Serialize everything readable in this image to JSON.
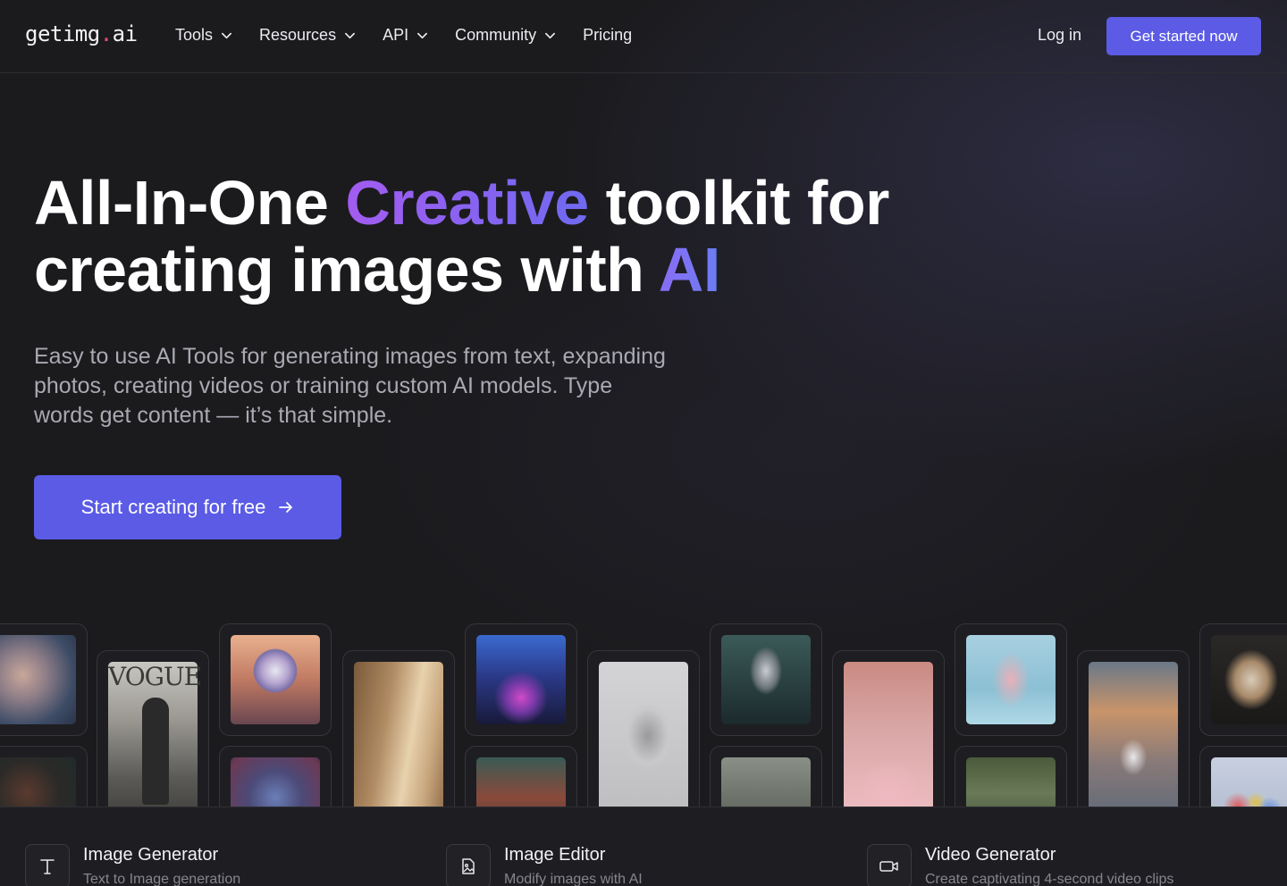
{
  "brand": {
    "logo_pre": "getimg",
    "logo_dot": ".",
    "logo_post": "ai"
  },
  "nav": {
    "items": [
      {
        "label": "Tools",
        "has_dropdown": true
      },
      {
        "label": "Resources",
        "has_dropdown": true
      },
      {
        "label": "API",
        "has_dropdown": true
      },
      {
        "label": "Community",
        "has_dropdown": true
      },
      {
        "label": "Pricing",
        "has_dropdown": false
      }
    ],
    "login": "Log in",
    "cta": "Get started now"
  },
  "hero": {
    "line1_a": "All-In-One ",
    "line1_highlight": "Creative",
    "line1_b": " toolkit for",
    "line2_a": "creating images with ",
    "line2_highlight": "AI",
    "subtitle": "Easy to use AI Tools for generating images from text, expanding photos, creating videos or training custom AI models. Type words get content — it’s that simple.",
    "cta": "Start creating for free"
  },
  "gallery": {
    "vogue_text": "VOGUE",
    "images": [
      "portrait-woman-face",
      "dark-portrait",
      "vogue-cover-statue",
      "chrome-sphere-landscape",
      "blue-hair-figure",
      "minimal-room-light",
      "neon-robot-city",
      "face-closeup",
      "wire-sketch-head",
      "alien-bust",
      "misty-figure",
      "pink-bedroom-teddy",
      "glass-dancer",
      "greenhouse-interior",
      "astronaut-doorway",
      "marble-bust",
      "balloons"
    ]
  },
  "features": [
    {
      "title": "Image Generator",
      "desc": "Text to Image generation",
      "icon": "text-t-icon"
    },
    {
      "title": "Image Editor",
      "desc": "Modify images with AI",
      "icon": "image-edit-icon"
    },
    {
      "title": "Video Generator",
      "desc": "Create captivating 4-second video clips",
      "icon": "video-camera-icon"
    }
  ],
  "colors": {
    "accent": "#5b5be6",
    "logo_dot": "#e3506e",
    "gradient_start": "#a35cf0",
    "gradient_end": "#6f6af0",
    "background": "#1b1b1e"
  }
}
